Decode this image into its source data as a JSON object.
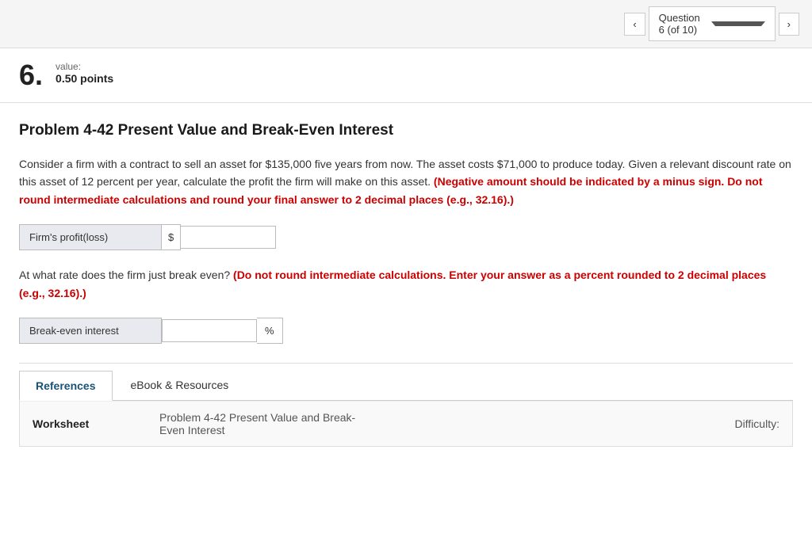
{
  "nav": {
    "prev_label": "‹",
    "next_label": "›",
    "question_label": "Question 6 (of 10)"
  },
  "question": {
    "number": "6.",
    "value_label": "value:",
    "value_points": "0.50 points"
  },
  "problem": {
    "title": "Problem 4-42 Present Value and Break-Even Interest",
    "body_text": "Consider a firm with a contract to sell an asset for $135,000 five years from now. The asset costs $71,000 to produce today. Given a relevant discount rate on this asset of 12 percent per year, calculate the profit the firm will make on this asset.",
    "red_text_1": "(Negative amount should be indicated by a minus sign. Do not round intermediate calculations and round your final answer to 2 decimal places (e.g., 32.16).)",
    "firm_profit_label": "Firm's profit(loss)",
    "currency_symbol": "$",
    "firm_profit_placeholder": "",
    "break_even_text": "At what rate does the firm just break even?",
    "red_text_2": "(Do not round intermediate calculations. Enter your answer as a percent rounded to 2 decimal places (e.g., 32.16).)",
    "break_even_label": "Break-even interest",
    "percent_symbol": "%",
    "break_even_placeholder": ""
  },
  "tabs": {
    "active_tab": "References",
    "inactive_tab": "eBook & Resources"
  },
  "references": {
    "worksheet_label": "Worksheet",
    "worksheet_value": "Problem 4-42 Present Value and Break-Even Interest",
    "difficulty_label": "Difficulty:"
  }
}
